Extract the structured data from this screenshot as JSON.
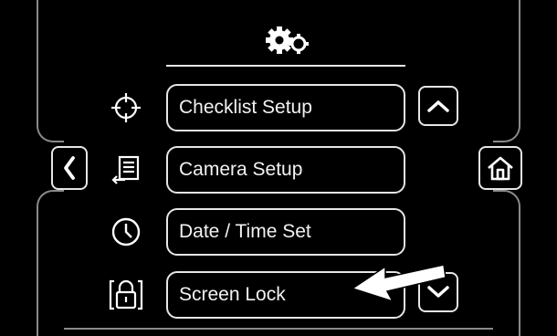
{
  "header": {
    "icon": "settings-gears-icon"
  },
  "menu": {
    "items": [
      {
        "label": "Checklist Setup",
        "icon": "crosshair-icon"
      },
      {
        "label": "Camera Setup",
        "icon": "document-arrow-icon"
      },
      {
        "label": "Date / Time Set",
        "icon": "clock-icon"
      },
      {
        "label": "Screen Lock",
        "icon": "padlock-icon"
      }
    ]
  },
  "nav": {
    "back_icon": "chevron-left-icon",
    "home_icon": "home-icon",
    "scroll_up_icon": "chevron-up-icon",
    "scroll_down_icon": "chevron-down-icon"
  },
  "annotation": {
    "icon": "pointer-arrow-icon"
  },
  "colors": {
    "background": "#000000",
    "foreground": "#ffffff",
    "frame": "#8a8a8a"
  }
}
